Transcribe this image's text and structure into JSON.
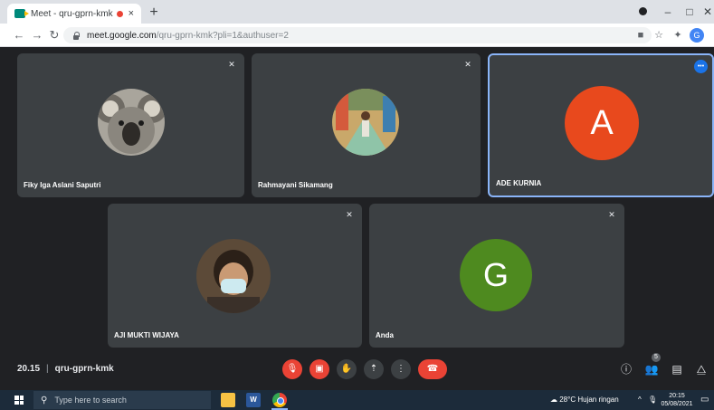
{
  "browser": {
    "tab_title": "Meet - qru-gprn-kmk",
    "tab_close": "×",
    "new_tab": "+",
    "url_host": "meet.google.com",
    "url_path": "/qru-gprn-kmk?pli=1&authuser=2",
    "profile_initial": "G",
    "window_controls": {
      "minimize": "–",
      "maximize": "□",
      "close": "✕"
    }
  },
  "meeting": {
    "time": "20.15",
    "separator": "|",
    "code": "qru-gprn-kmk",
    "participant_count": "5",
    "participants": [
      {
        "name": "Fiky Iga Aslani Saputri",
        "muted": true,
        "avatar": "koala-photo"
      },
      {
        "name": "Rahmayani Sikamang",
        "muted": true,
        "avatar": "person-photo"
      },
      {
        "name": "ADE KURNIA",
        "muted": false,
        "speaking": true,
        "avatar_letter": "A",
        "avatar_color": "#e8491d"
      },
      {
        "name": "AJI MUKTI WIJAYA",
        "muted": true,
        "avatar": "person-mask-photo"
      },
      {
        "name": "Anda",
        "muted": true,
        "avatar_letter": "G",
        "avatar_color": "#4e8a1f"
      }
    ]
  },
  "taskbar": {
    "search_placeholder": "Type here to search",
    "weather": "28°C  Hujan ringan",
    "time": "20:15",
    "date": "05/08/2021",
    "word_letter": "W"
  },
  "colors": {
    "meet_bg": "#202124",
    "tile_bg": "#3c4043",
    "active_border": "#8ab4f8",
    "danger": "#ea4335"
  }
}
